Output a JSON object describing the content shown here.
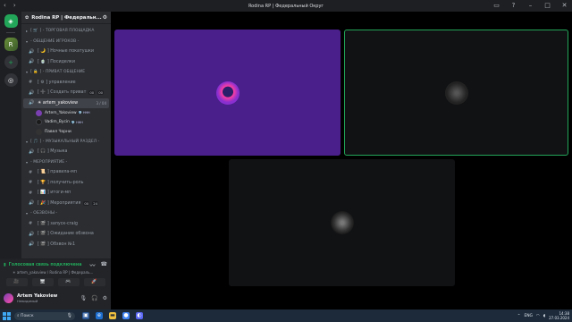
{
  "window": {
    "title": "Rodina RP | Федеральный Округ"
  },
  "server": {
    "name": "Rodina RP | Федеральн..."
  },
  "channels": [
    {
      "type": "category",
      "label": "[ 🛒 ] - ТОРГОВАЯ ПЛОЩАДКА"
    },
    {
      "type": "category",
      "label": "- ОБЩЕНИЕ ИГРОКОВ -"
    },
    {
      "type": "voice",
      "label": "[ 🌙 ] Ночные покатушки"
    },
    {
      "type": "voice",
      "label": "[ 🍵 ] Посиделки"
    },
    {
      "type": "category",
      "label": "[ 🔒 ] - ПРИВАТ ОБЩЕНИЕ"
    },
    {
      "type": "voice",
      "label": "[ ⚙ ] управление"
    },
    {
      "type": "voice",
      "label": "[ ➕ ] Создать приват",
      "badges": [
        "00",
        "00"
      ]
    },
    {
      "type": "voice",
      "label": "☀ artem_yakoview",
      "active": true,
      "count": "3 / 04"
    },
    {
      "type": "category",
      "label": "[ 🎵 ] - МУЗЫКАЛЬНЫЙ РАЗДЕЛ -"
    },
    {
      "type": "voice",
      "label": "[ 🎧 ] Музыка"
    },
    {
      "type": "category",
      "label": "- МЕРОПРИЯТИЕ -"
    },
    {
      "type": "voice",
      "label": "[ 📜 ] правила-мп"
    },
    {
      "type": "voice",
      "label": "[ 🏆 ] получить-роль"
    },
    {
      "type": "voice",
      "label": "[ 📊 ] итоги-мп"
    },
    {
      "type": "voice",
      "label": "[ 🎉 ] Мероприятия",
      "badges": [
        "00",
        "24"
      ]
    },
    {
      "type": "category",
      "label": "- ОБЗВОНЫ -"
    },
    {
      "type": "voice",
      "label": "[ 🎬 ] запуск-craig"
    },
    {
      "type": "voice",
      "label": "[ 🎬 ] Ожидание обзвона"
    },
    {
      "type": "voice",
      "label": "[ 🎬 ] Обзвон №1"
    }
  ],
  "voice_users": [
    {
      "name": "Artem_Yakoview",
      "tag": "💎 ННН",
      "color": "#7a3fb0"
    },
    {
      "name": "Vadim_Bycin",
      "tag": "💎 ННН",
      "color": "#1a1a1a"
    },
    {
      "name": "Павел Чорни",
      "tag": "",
      "color": "#333"
    }
  ],
  "voice_panel": {
    "status": "Голосовая связь подключена",
    "location": "☀ artem_yakoview / Rodina RP | Федераль...",
    "actions": [
      "🎥",
      "🖥",
      "🎮",
      "🚀"
    ]
  },
  "user": {
    "name": "Artem Yakoview",
    "status": "Невидимый"
  },
  "taskbar": {
    "search_placeholder": "Поиск",
    "lang": "ENG",
    "time": "14:38",
    "date": "27.03.2024"
  }
}
